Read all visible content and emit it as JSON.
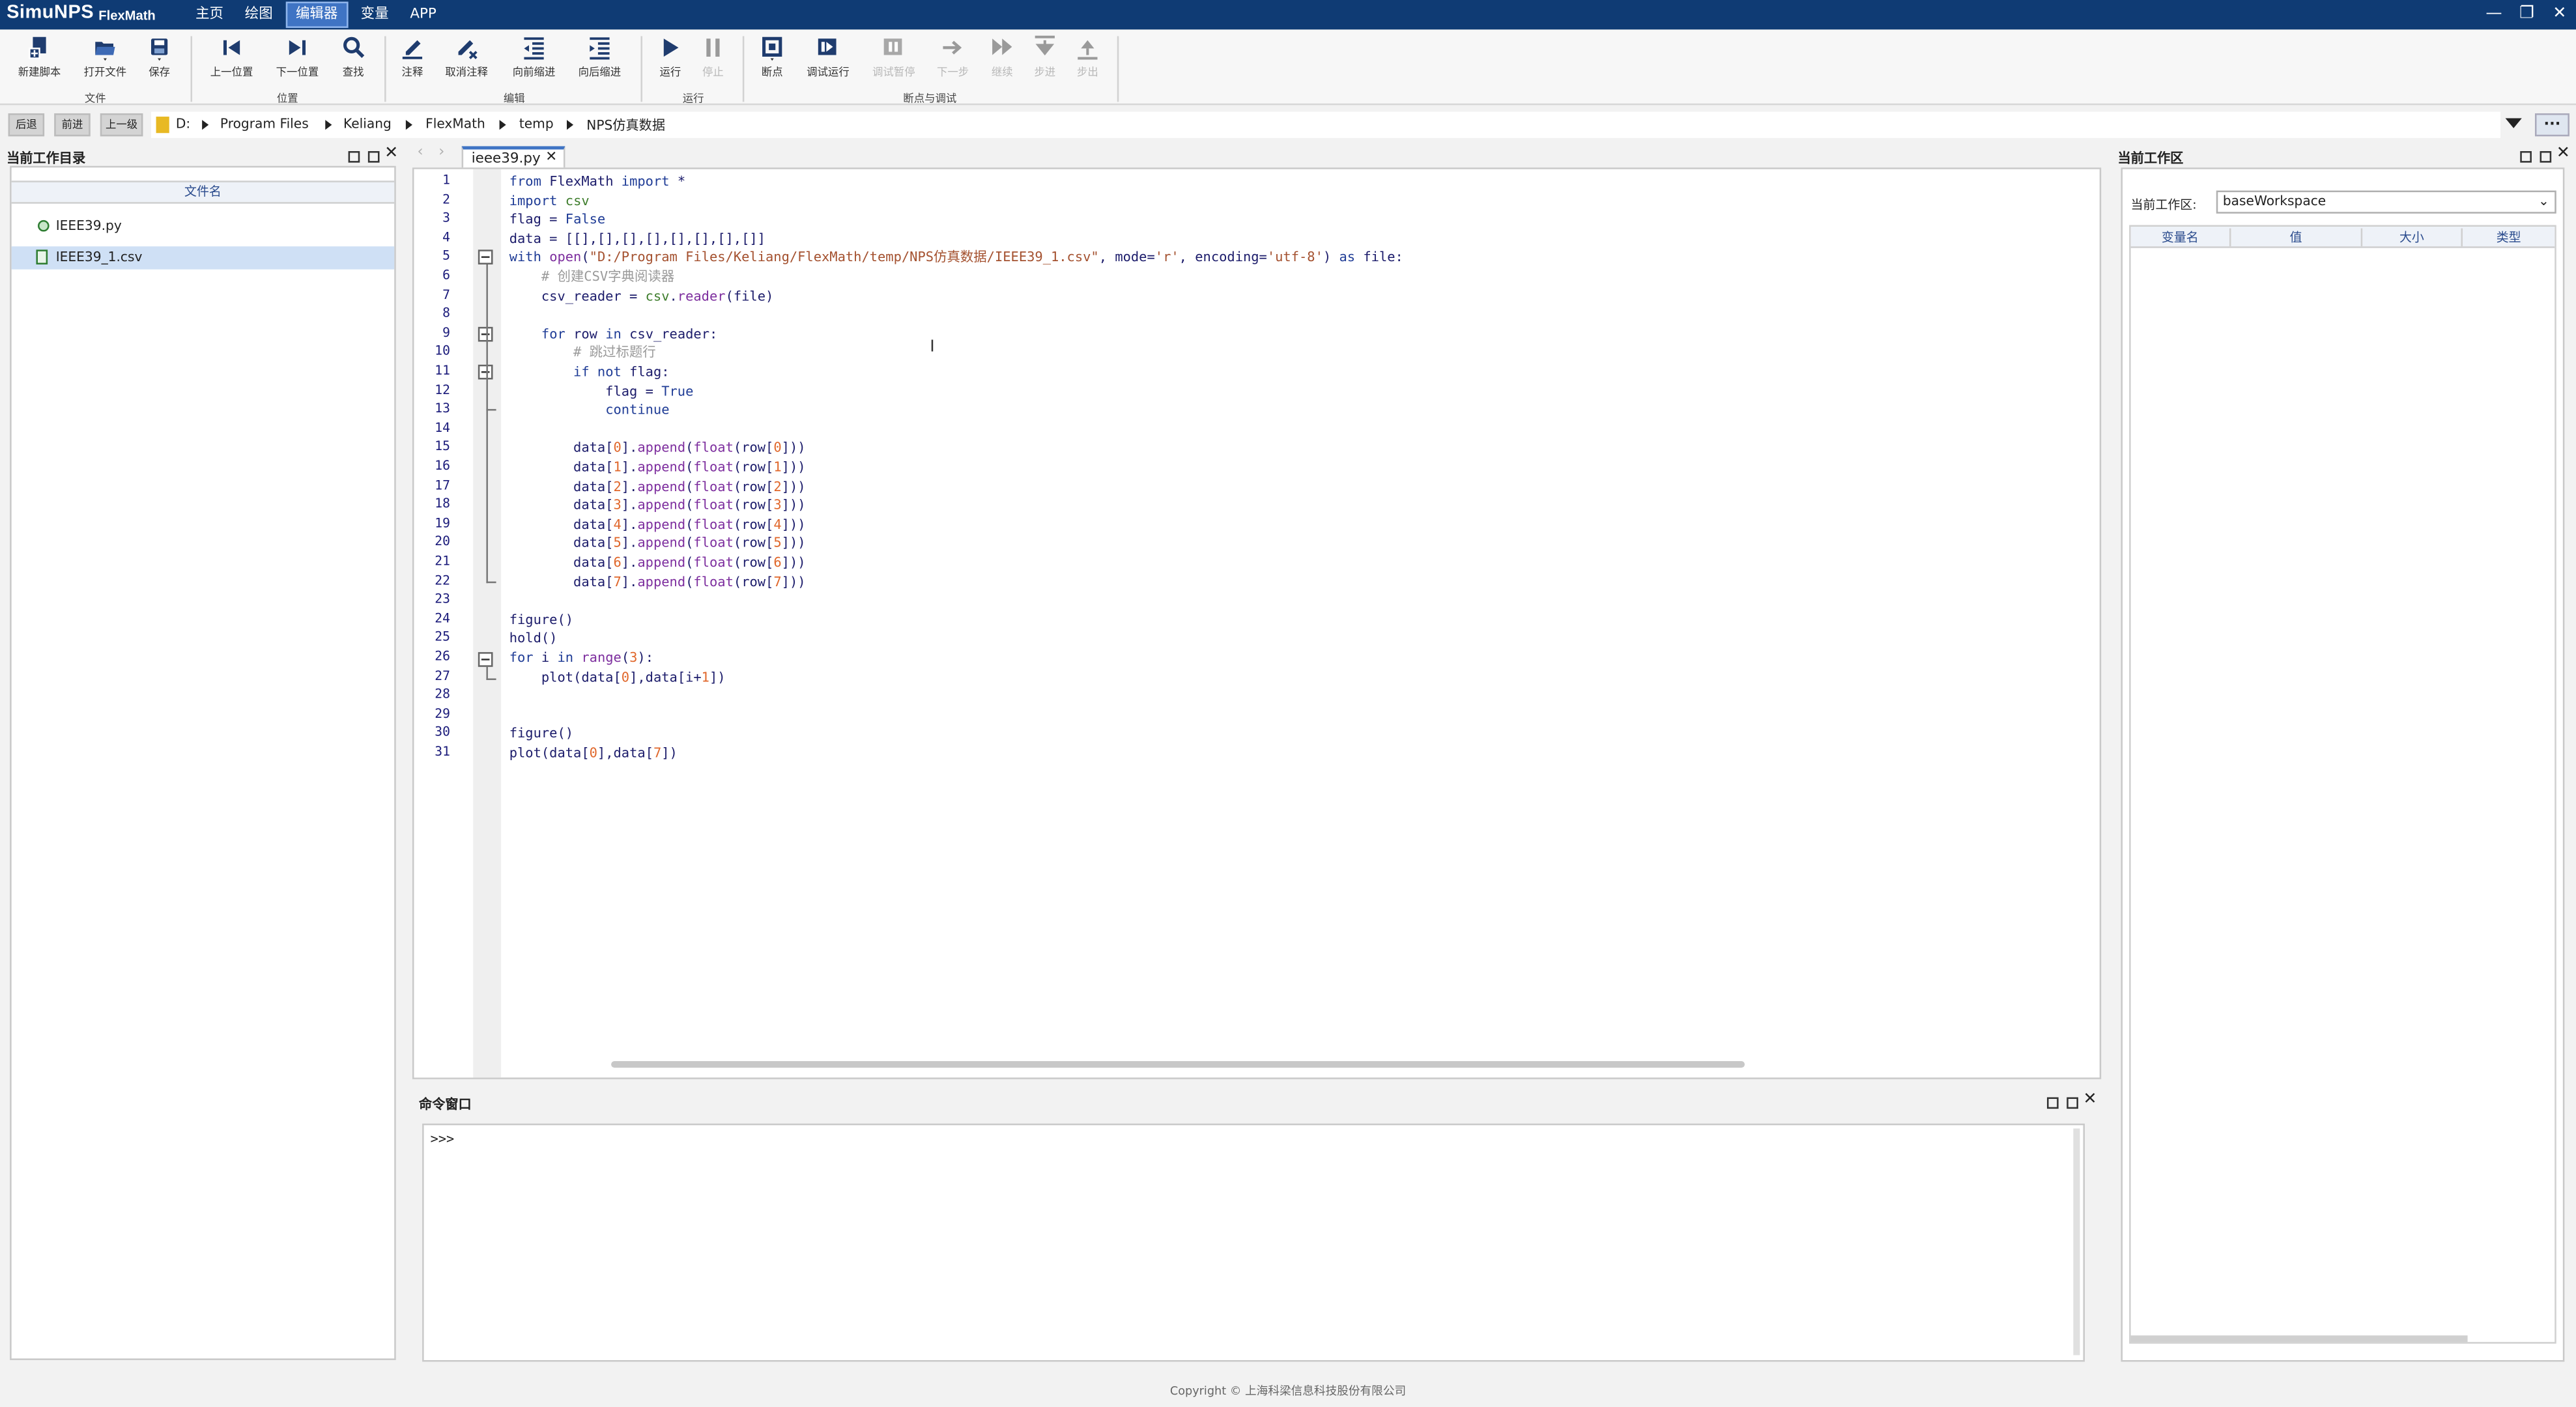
{
  "app": {
    "name": "SimuNPS",
    "subtitle": "FlexMath"
  },
  "menu": {
    "items": [
      "主页",
      "绘图",
      "编辑器",
      "变量",
      "APP"
    ],
    "active": "编辑器"
  },
  "window_controls": {
    "minimize": "—",
    "restore": "❐",
    "close": "✕"
  },
  "ribbon": {
    "file": {
      "new_script": "新建脚本",
      "open_file": "打开文件",
      "save": "保存",
      "group": "文件"
    },
    "position": {
      "prev": "上一位置",
      "next": "下一位置",
      "find": "查找",
      "group": "位置"
    },
    "edit": {
      "comment": "注释",
      "uncomment": "取消注释",
      "indent_left": "向前缩进",
      "indent_right": "向后缩进",
      "group": "编辑"
    },
    "run": {
      "run": "运行",
      "stop": "停止",
      "group": "运行"
    },
    "debug": {
      "breakpoint": "断点",
      "debug_run": "调试运行",
      "debug_pause": "调试暂停",
      "next_step": "下一步",
      "continue": "继续",
      "step_in": "步进",
      "step_out": "步出",
      "group": "断点与调试"
    }
  },
  "nav": {
    "back": "后退",
    "forward": "前进",
    "up": "上一级",
    "more": "..."
  },
  "breadcrumb": [
    "D:",
    "Program Files",
    "Keliang",
    "FlexMath",
    "temp",
    "NPS仿真数据"
  ],
  "left_panel": {
    "title": "当前工作目录",
    "column": "文件名",
    "files": [
      {
        "name": "IEEE39.py",
        "icon": "python-file-icon",
        "selected": false
      },
      {
        "name": "IEEE39_1.csv",
        "icon": "csv-file-icon",
        "selected": true
      }
    ]
  },
  "editor": {
    "tab": "ieee39.py",
    "lines": [
      "from FlexMath import *",
      "import csv",
      "flag = False",
      "data = [[],[],[],[],[],[],[],[]]",
      "with open(\"D:/Program Files/Keliang/FlexMath/temp/NPS仿真数据/IEEE39_1.csv\", mode='r', encoding='utf-8') as file:",
      "    # 创建CSV字典阅读器",
      "    csv_reader = csv.reader(file)",
      "",
      "    for row in csv_reader:",
      "        # 跳过标题行",
      "        if not flag:",
      "            flag = True",
      "            continue",
      "",
      "        data[0].append(float(row[0]))",
      "        data[1].append(float(row[1]))",
      "        data[2].append(float(row[2]))",
      "        data[3].append(float(row[3]))",
      "        data[4].append(float(row[4]))",
      "        data[5].append(float(row[5]))",
      "        data[6].append(float(row[6]))",
      "        data[7].append(float(row[7]))",
      "",
      "figure()",
      "hold()",
      "for i in range(3):",
      "    plot(data[0],data[i+1])",
      "",
      "",
      "figure()",
      "plot(data[0],data[7])"
    ]
  },
  "command_window": {
    "title": "命令窗口",
    "prompt": ">>>"
  },
  "workspace": {
    "title": "当前工作区",
    "label": "当前工作区:",
    "selected": "baseWorkspace",
    "columns": [
      "变量名",
      "值",
      "大小",
      "类型"
    ]
  },
  "footer": {
    "copyright": "Copyright © 上海科梁信息科技股份有限公司"
  },
  "colors": {
    "titlebar": "#0f3b74",
    "active_menu": "#3f74c4",
    "selection": "#cfe0f5"
  }
}
